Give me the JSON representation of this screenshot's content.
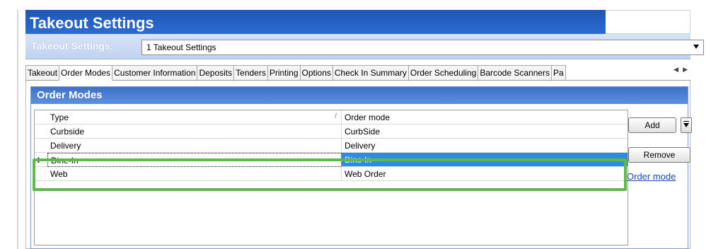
{
  "window": {
    "title": "Takeout Settings"
  },
  "settings": {
    "label": "Takeout Settings:",
    "selected": "1 Takeout Settings"
  },
  "tabs": [
    {
      "label": "Takeout"
    },
    {
      "label": "Order Modes"
    },
    {
      "label": "Customer Information"
    },
    {
      "label": "Deposits"
    },
    {
      "label": "Tenders"
    },
    {
      "label": "Printing"
    },
    {
      "label": "Options"
    },
    {
      "label": "Check In Summary"
    },
    {
      "label": "Order Scheduling"
    },
    {
      "label": "Barcode Scanners"
    },
    {
      "label": "Pa"
    }
  ],
  "active_tab": "Order Modes",
  "order_modes": {
    "header": "Order Modes",
    "columns": {
      "type": "Type",
      "mode": "Order mode"
    },
    "rows": [
      {
        "type": "Curbside",
        "mode": "CurbSide"
      },
      {
        "type": "Delivery",
        "mode": "Delivery"
      },
      {
        "type": "Dine-In",
        "mode": "Dine In"
      },
      {
        "type": "Web",
        "mode": "Web Order"
      }
    ],
    "selected_row": "Dine-In",
    "row_marker": "I"
  },
  "actions": {
    "add": "Add",
    "remove": "Remove",
    "link": "Order mode"
  },
  "colors": {
    "title_blue": "#2f6bd0",
    "selection_blue": "#2f8ae6",
    "highlight_green": "#5fb84a"
  }
}
